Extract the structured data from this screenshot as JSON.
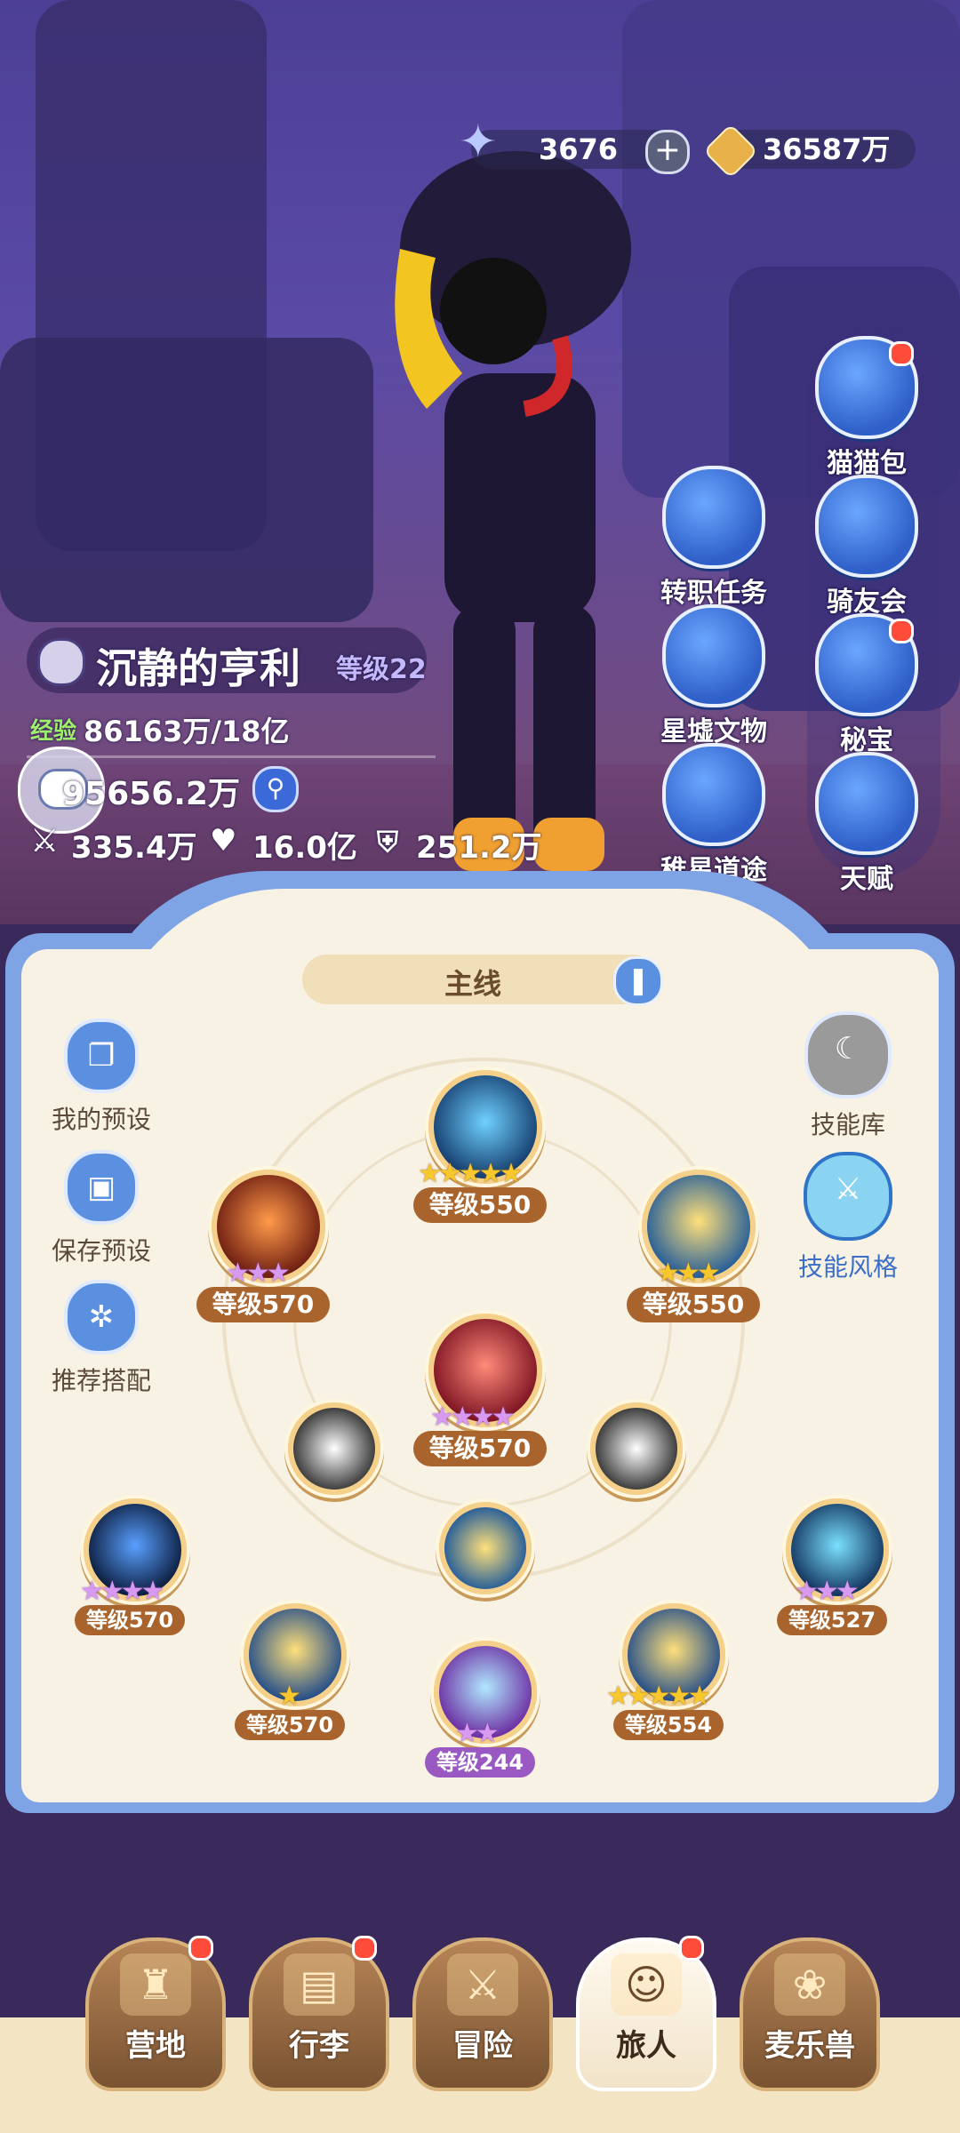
{
  "currency": {
    "gems": "3676",
    "gold": "36587万"
  },
  "side_buttons": [
    {
      "label": "猫猫包",
      "badge": true
    },
    {
      "label": "转职任务",
      "badge": false
    },
    {
      "label": "骑友会",
      "badge": false
    },
    {
      "label": "星墟文物",
      "badge": false
    },
    {
      "label": "秘宝",
      "badge": true
    },
    {
      "label": "稚星道途",
      "badge": false
    },
    {
      "label": "天赋",
      "badge": false
    }
  ],
  "player": {
    "name": "沉静的亨利",
    "level": "等级22",
    "exp_label": "经验",
    "exp_value": "86163万/18亿",
    "power": "95656.2万",
    "attack": "335.4万",
    "hp": "16.0亿",
    "defense": "251.2万"
  },
  "panel": {
    "tab_title": "主线",
    "left_buttons": [
      "我的预设",
      "保存预设",
      "推荐搭配"
    ],
    "right_buttons": [
      "技能库",
      "技能风格"
    ]
  },
  "skills": [
    {
      "level": "等级550",
      "stars": 5,
      "star_color": "gold"
    },
    {
      "level": "等级570",
      "stars": 3,
      "star_color": "pink"
    },
    {
      "level": "等级550",
      "stars": 3,
      "star_color": "gold"
    },
    {
      "level": "等级570",
      "stars": 4,
      "star_color": "pink"
    },
    {
      "level": "等级570",
      "stars": 4,
      "star_color": "pink"
    },
    {
      "level": "等级527",
      "stars": 3,
      "star_color": "pink"
    },
    {
      "level": "等级570",
      "stars": 1,
      "star_color": "gold"
    },
    {
      "level": "等级244",
      "stars": 2,
      "star_color": "pink"
    },
    {
      "level": "等级554",
      "stars": 5,
      "star_color": "gold"
    }
  ],
  "nav": [
    {
      "label": "营地",
      "badge": true,
      "active": false
    },
    {
      "label": "行李",
      "badge": true,
      "active": false
    },
    {
      "label": "冒险",
      "badge": false,
      "active": false
    },
    {
      "label": "旅人",
      "badge": true,
      "active": true
    },
    {
      "label": "麦乐兽",
      "badge": false,
      "active": false
    }
  ],
  "icons": {
    "gem": "gem-icon",
    "gold": "gold-coin-icon",
    "plus": "plus-icon",
    "search": "search-icon",
    "attack": "crossed-swords-icon",
    "hp": "heart-icon",
    "defense": "shield-icon"
  },
  "colors": {
    "accent": "#5b8fe0",
    "level_badge": "#a8642c",
    "level_badge_purple": "#9a59c2",
    "badge_red": "#ff4b3a"
  }
}
